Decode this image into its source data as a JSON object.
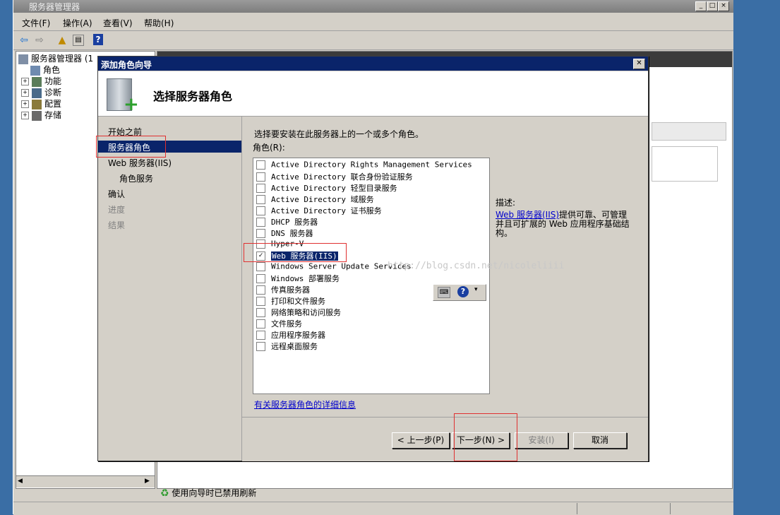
{
  "server_manager": {
    "title": "服务器管理器",
    "menu": [
      "文件(F)",
      "操作(A)",
      "查看(V)",
      "帮助(H)"
    ],
    "tree": {
      "root": "服务器管理器 (1",
      "items": [
        {
          "label": "角色",
          "expandable": false
        },
        {
          "label": "功能",
          "expandable": true
        },
        {
          "label": "诊断",
          "expandable": true
        },
        {
          "label": "配置",
          "expandable": true
        },
        {
          "label": "存储",
          "expandable": true
        }
      ]
    },
    "status": "使用向导时已禁用刷新"
  },
  "dialog": {
    "title": "添加角色向导",
    "heading": "选择服务器角色",
    "nav": [
      {
        "label": "开始之前",
        "state": "normal"
      },
      {
        "label": "服务器角色",
        "state": "selected"
      },
      {
        "label": "Web 服务器(IIS)",
        "state": "normal"
      },
      {
        "label": "角色服务",
        "state": "normal",
        "indent": true
      },
      {
        "label": "确认",
        "state": "normal"
      },
      {
        "label": "进度",
        "state": "disabled"
      },
      {
        "label": "结果",
        "state": "disabled"
      }
    ],
    "instruction": "选择要安装在此服务器上的一个或多个角色。",
    "roles_label": "角色(R):",
    "roles": [
      {
        "label": "Active Directory Rights Management Services",
        "checked": false
      },
      {
        "label": "Active Directory 联合身份验证服务",
        "checked": false
      },
      {
        "label": "Active Directory 轻型目录服务",
        "checked": false
      },
      {
        "label": "Active Directory 域服务",
        "checked": false
      },
      {
        "label": "Active Directory 证书服务",
        "checked": false
      },
      {
        "label": "DHCP 服务器",
        "checked": false
      },
      {
        "label": "DNS 服务器",
        "checked": false
      },
      {
        "label": "Hyper-V",
        "checked": false
      },
      {
        "label": "Web 服务器(IIS)",
        "checked": true
      },
      {
        "label": "Windows Server Update Services",
        "checked": false
      },
      {
        "label": "Windows 部署服务",
        "checked": false
      },
      {
        "label": "传真服务器",
        "checked": false
      },
      {
        "label": "打印和文件服务",
        "checked": false
      },
      {
        "label": "网络策略和访问服务",
        "checked": false
      },
      {
        "label": "文件服务",
        "checked": false
      },
      {
        "label": "应用程序服务器",
        "checked": false
      },
      {
        "label": "远程桌面服务",
        "checked": false
      }
    ],
    "description_label": "描述:",
    "description_link": "Web 服务器(IIS)",
    "description_text": "提供可靠、可管理并且可扩展的 Web 应用程序基础结构。",
    "more_info_link": "有关服务器角色的详细信息",
    "watermark": "http://blog.csdn.net/nicoleliiii",
    "buttons": {
      "back": "< 上一步(P)",
      "next": "下一步(N) >",
      "install": "安装(I)",
      "cancel": "取消"
    }
  }
}
